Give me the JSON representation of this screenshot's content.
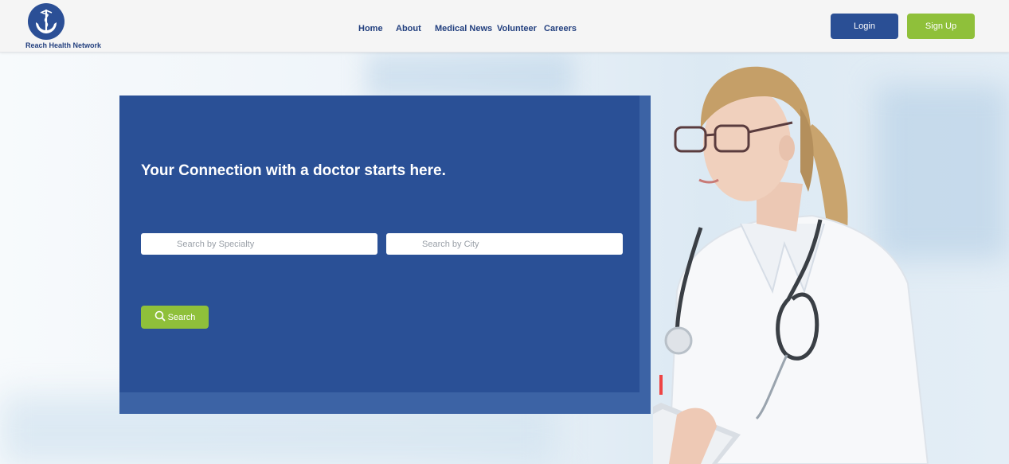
{
  "header": {
    "brand": "Reach Health Network",
    "nav": [
      {
        "label": "Home",
        "name": "nav-home"
      },
      {
        "label": "About",
        "name": "nav-about"
      },
      {
        "label": "Medical News",
        "name": "nav-medical-news"
      },
      {
        "label": "Volunteer",
        "name": "nav-volunteer"
      },
      {
        "label": "Careers",
        "name": "nav-careers"
      }
    ],
    "login_label": "Login",
    "signup_label": "Sign Up"
  },
  "hero": {
    "headline": "Your Connection with a doctor starts here.",
    "specialty": {
      "placeholder": "Search by Specialty",
      "value": ""
    },
    "city": {
      "placeholder": "Search by City",
      "value": ""
    },
    "search_label": "Search"
  },
  "icons": {
    "logo": "hands-caduceus-logo-icon",
    "search": "magnifier-search-icon"
  },
  "colors": {
    "primary_blue": "#2a5096",
    "accent_green": "#8fc03a",
    "nav_text": "#23407f"
  }
}
